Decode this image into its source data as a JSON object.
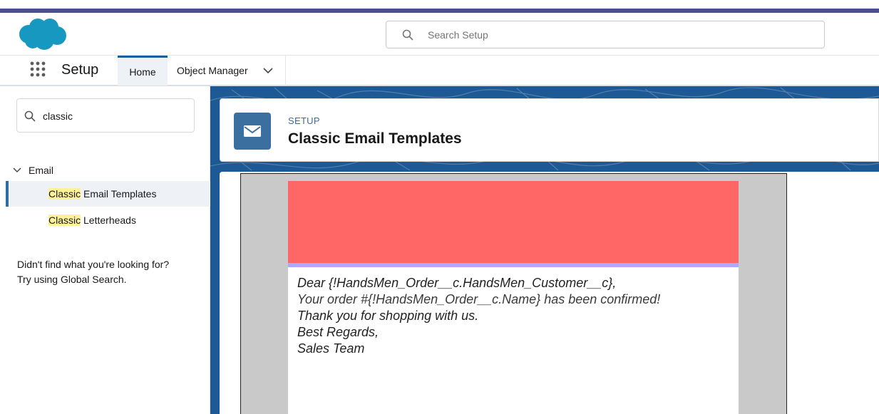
{
  "header": {
    "search_placeholder": "Search Setup",
    "brand_color": "#4b4f8c"
  },
  "nav": {
    "app_name": "Setup",
    "tabs": [
      {
        "label": "Home",
        "active": true
      },
      {
        "label": "Object Manager",
        "active": false
      }
    ]
  },
  "sidebar": {
    "quick_find_value": "classic",
    "group": {
      "label": "Email",
      "expanded": true
    },
    "items": [
      {
        "highlight": "Classic",
        "rest": " Email Templates",
        "active": true
      },
      {
        "highlight": "Classic",
        "rest": " Letterheads",
        "active": false
      }
    ],
    "help_line1": "Didn't find what you're looking for?",
    "help_line2": "Try using Global Search."
  },
  "page": {
    "label": "SETUP",
    "title": "Classic Email Templates",
    "icon": "envelope-icon"
  },
  "email": {
    "banner_color": "#ff6666",
    "lines": [
      "Dear {!HandsMen_Order__c.HandsMen_Customer__c},",
      "Your order #{!HandsMen_Order__c.Name} has been confirmed!",
      "Thank you for shopping with us.",
      "Best Regards,",
      "Sales Team"
    ]
  }
}
